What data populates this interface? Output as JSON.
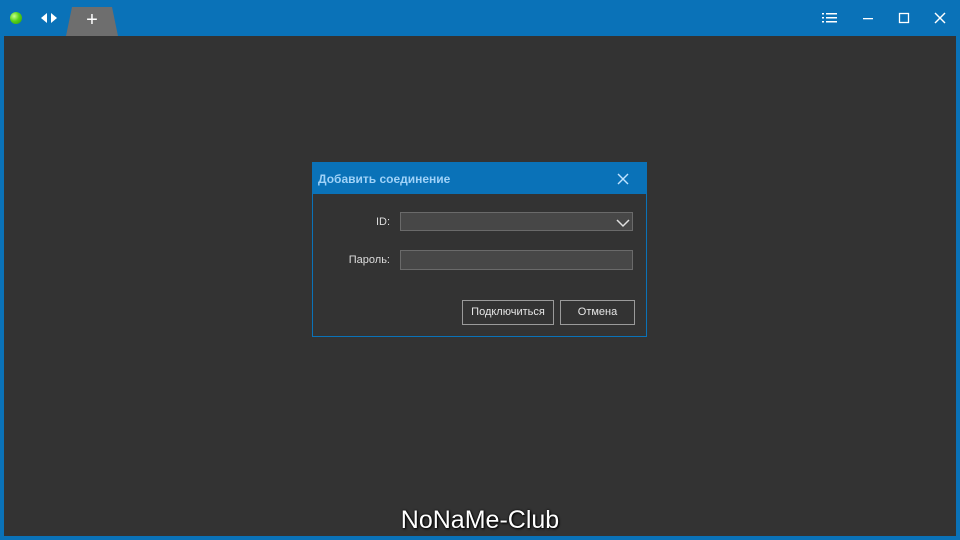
{
  "titlebar": {
    "status_icon": "green-status-dot",
    "nav_icon": "left-right-arrows-icon",
    "new_tab_label": "+",
    "controls": [
      "menu-icon",
      "minimize-icon",
      "maximize-icon",
      "close-icon"
    ]
  },
  "dialog": {
    "title": "Добавить соединение",
    "id_label": "ID:",
    "id_value": "",
    "password_label": "Пароль:",
    "password_value": "",
    "connect_label": "Подключиться",
    "cancel_label": "Отмена"
  },
  "watermark": "NoNaMe-Club",
  "colors": {
    "accent": "#0a72b8",
    "background": "#333333",
    "input_bg": "#474747",
    "title_text": "#9fd2f8"
  }
}
